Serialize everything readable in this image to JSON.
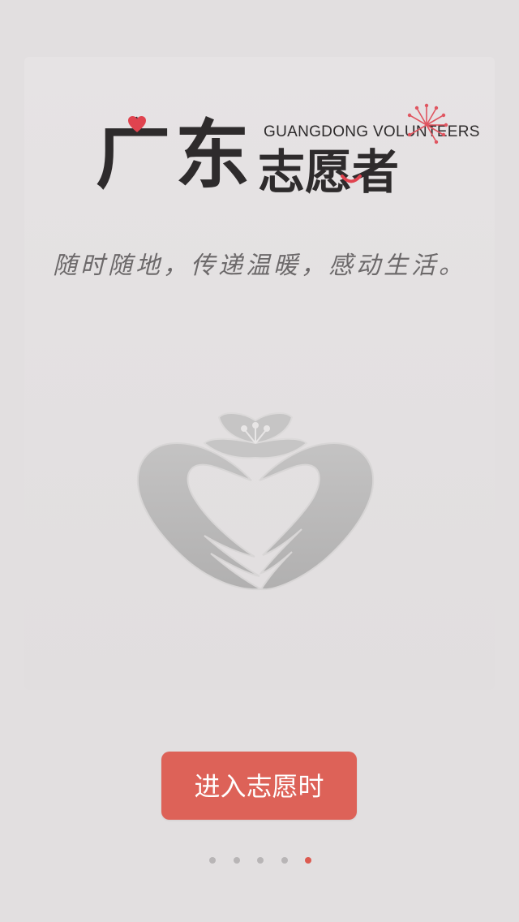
{
  "logo": {
    "title_large": "广东",
    "title_small": "志愿者",
    "subtitle_en": "GUANGDONG VOLUNTEERS"
  },
  "slogan": "随时随地，传递温暖，感动生活。",
  "emblem": {
    "icon": "heart-hands-flower-icon"
  },
  "enter_button": {
    "label": "进入志愿时"
  },
  "pager": {
    "count": 5,
    "active_index": 4
  },
  "colors": {
    "background": "#e2dfe0",
    "accent": "#dd6258",
    "logo_text": "#2e2b2c",
    "slogan_text": "#6c696a",
    "emblem": "#b9b8b8",
    "dot_inactive": "#b8b5b6",
    "dot_active": "#dc5a50"
  }
}
